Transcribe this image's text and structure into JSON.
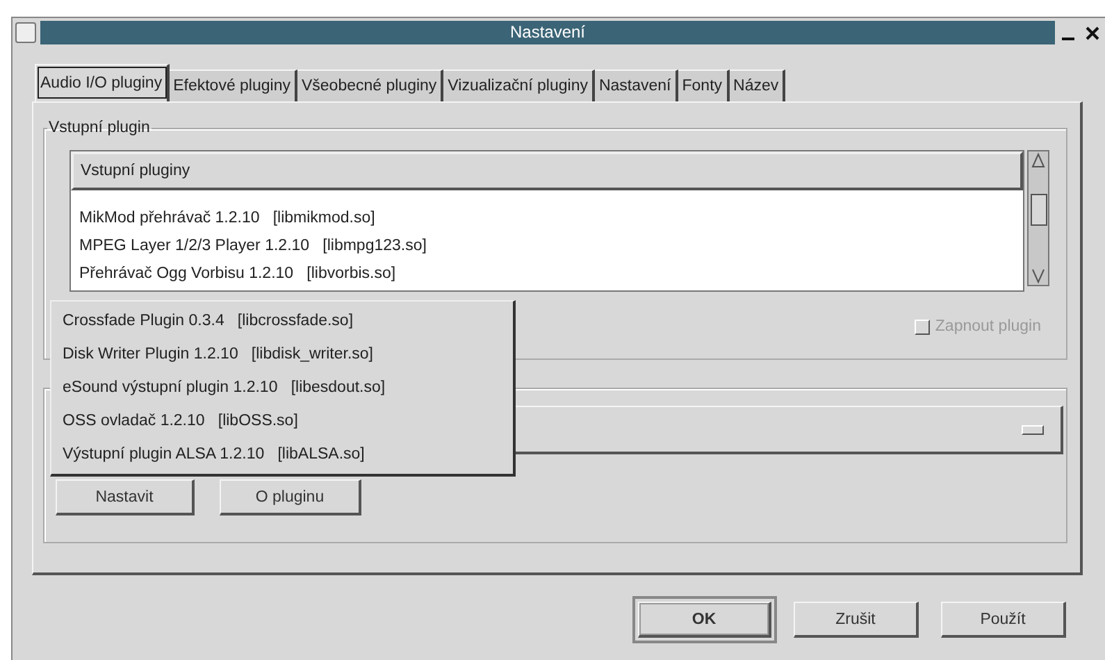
{
  "window": {
    "title": "Nastavení"
  },
  "tabs": [
    {
      "label": "Audio I/O pluginy",
      "selected": true
    },
    {
      "label": "Efektové pluginy",
      "selected": false
    },
    {
      "label": "Všeobecné pluginy",
      "selected": false
    },
    {
      "label": "Vizualizační pluginy",
      "selected": false
    },
    {
      "label": "Nastavení",
      "selected": false
    },
    {
      "label": "Fonty",
      "selected": false
    },
    {
      "label": "Název",
      "selected": false
    }
  ],
  "input_group": {
    "title": "Vstupní plugin",
    "list_header": "Vstupní pluginy",
    "rows": [
      "MikMod přehrávač 1.2.10   [libmikmod.so]",
      "MPEG Layer 1/2/3 Player 1.2.10   [libmpg123.so]",
      "Přehrávač Ogg Vorbisu 1.2.10   [libvorbis.so]"
    ],
    "enable_checkbox": {
      "label": "Zapnout plugin",
      "checked": false,
      "disabled": true
    }
  },
  "output_group": {
    "dropdown_options": [
      "Crossfade Plugin 0.3.4   [libcrossfade.so]",
      "Disk Writer Plugin 1.2.10   [libdisk_writer.so]",
      "eSound výstupní plugin 1.2.10   [libesdout.so]",
      "OSS ovladač 1.2.10   [libOSS.so]",
      "Výstupní plugin ALSA 1.2.10   [libALSA.so]"
    ],
    "buttons": [
      "Nastavit",
      "O pluginu"
    ]
  },
  "buttons": [
    {
      "label": "OK",
      "default": true
    },
    {
      "label": "Zrušit",
      "default": false
    },
    {
      "label": "Použít",
      "default": false
    }
  ]
}
